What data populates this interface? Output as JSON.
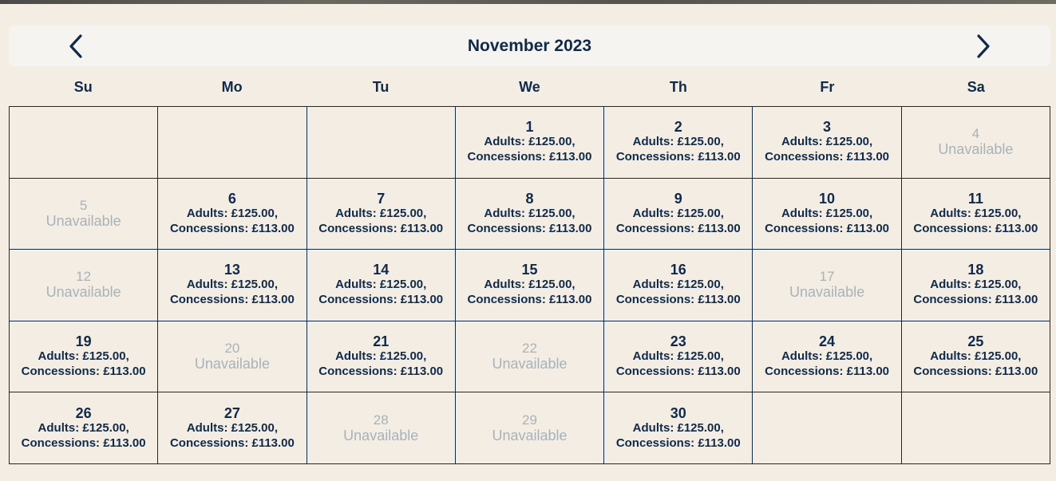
{
  "calendar": {
    "month_label": "November 2023",
    "weekdays": [
      "Su",
      "Mo",
      "Tu",
      "We",
      "Th",
      "Fr",
      "Sa"
    ],
    "colors": {
      "text": "#0f2a4a",
      "unavailable": "#a7b3b9",
      "background": "#f4ede3"
    },
    "weeks": [
      [
        {
          "day": "",
          "status": "empty"
        },
        {
          "day": "",
          "status": "empty"
        },
        {
          "day": "",
          "status": "empty"
        },
        {
          "day": "1",
          "status": "available",
          "adults": "Adults: £125.00,",
          "concessions": "Concessions: £113.00"
        },
        {
          "day": "2",
          "status": "available",
          "adults": "Adults: £125.00,",
          "concessions": "Concessions: £113.00"
        },
        {
          "day": "3",
          "status": "available",
          "adults": "Adults: £125.00,",
          "concessions": "Concessions: £113.00"
        },
        {
          "day": "4",
          "status": "unavailable",
          "label": "Unavailable"
        }
      ],
      [
        {
          "day": "5",
          "status": "unavailable",
          "label": "Unavailable"
        },
        {
          "day": "6",
          "status": "available",
          "adults": "Adults: £125.00,",
          "concessions": "Concessions: £113.00"
        },
        {
          "day": "7",
          "status": "available",
          "adults": "Adults: £125.00,",
          "concessions": "Concessions: £113.00"
        },
        {
          "day": "8",
          "status": "available",
          "adults": "Adults: £125.00,",
          "concessions": "Concessions: £113.00"
        },
        {
          "day": "9",
          "status": "available",
          "adults": "Adults: £125.00,",
          "concessions": "Concessions: £113.00"
        },
        {
          "day": "10",
          "status": "available",
          "adults": "Adults: £125.00,",
          "concessions": "Concessions: £113.00"
        },
        {
          "day": "11",
          "status": "available",
          "adults": "Adults: £125.00,",
          "concessions": "Concessions: £113.00"
        }
      ],
      [
        {
          "day": "12",
          "status": "unavailable",
          "label": "Unavailable"
        },
        {
          "day": "13",
          "status": "available",
          "adults": "Adults: £125.00,",
          "concessions": "Concessions: £113.00"
        },
        {
          "day": "14",
          "status": "available",
          "adults": "Adults: £125.00,",
          "concessions": "Concessions: £113.00"
        },
        {
          "day": "15",
          "status": "available",
          "adults": "Adults: £125.00,",
          "concessions": "Concessions: £113.00"
        },
        {
          "day": "16",
          "status": "available",
          "adults": "Adults: £125.00,",
          "concessions": "Concessions: £113.00"
        },
        {
          "day": "17",
          "status": "unavailable",
          "label": "Unavailable"
        },
        {
          "day": "18",
          "status": "available",
          "adults": "Adults: £125.00,",
          "concessions": "Concessions: £113.00"
        }
      ],
      [
        {
          "day": "19",
          "status": "available",
          "adults": "Adults: £125.00,",
          "concessions": "Concessions: £113.00"
        },
        {
          "day": "20",
          "status": "unavailable",
          "label": "Unavailable"
        },
        {
          "day": "21",
          "status": "available",
          "adults": "Adults: £125.00,",
          "concessions": "Concessions: £113.00"
        },
        {
          "day": "22",
          "status": "unavailable",
          "label": "Unavailable"
        },
        {
          "day": "23",
          "status": "available",
          "adults": "Adults: £125.00,",
          "concessions": "Concessions: £113.00"
        },
        {
          "day": "24",
          "status": "available",
          "adults": "Adults: £125.00,",
          "concessions": "Concessions: £113.00"
        },
        {
          "day": "25",
          "status": "available",
          "adults": "Adults: £125.00,",
          "concessions": "Concessions: £113.00"
        }
      ],
      [
        {
          "day": "26",
          "status": "available",
          "adults": "Adults: £125.00,",
          "concessions": "Concessions: £113.00"
        },
        {
          "day": "27",
          "status": "available",
          "adults": "Adults: £125.00,",
          "concessions": "Concessions: £113.00"
        },
        {
          "day": "28",
          "status": "unavailable",
          "label": "Unavailable"
        },
        {
          "day": "29",
          "status": "unavailable",
          "label": "Unavailable"
        },
        {
          "day": "30",
          "status": "available",
          "adults": "Adults: £125.00,",
          "concessions": "Concessions: £113.00"
        },
        {
          "day": "",
          "status": "empty"
        },
        {
          "day": "",
          "status": "empty"
        }
      ]
    ],
    "icons": {
      "prev": "chevron-left-icon",
      "next": "chevron-right-icon"
    }
  }
}
